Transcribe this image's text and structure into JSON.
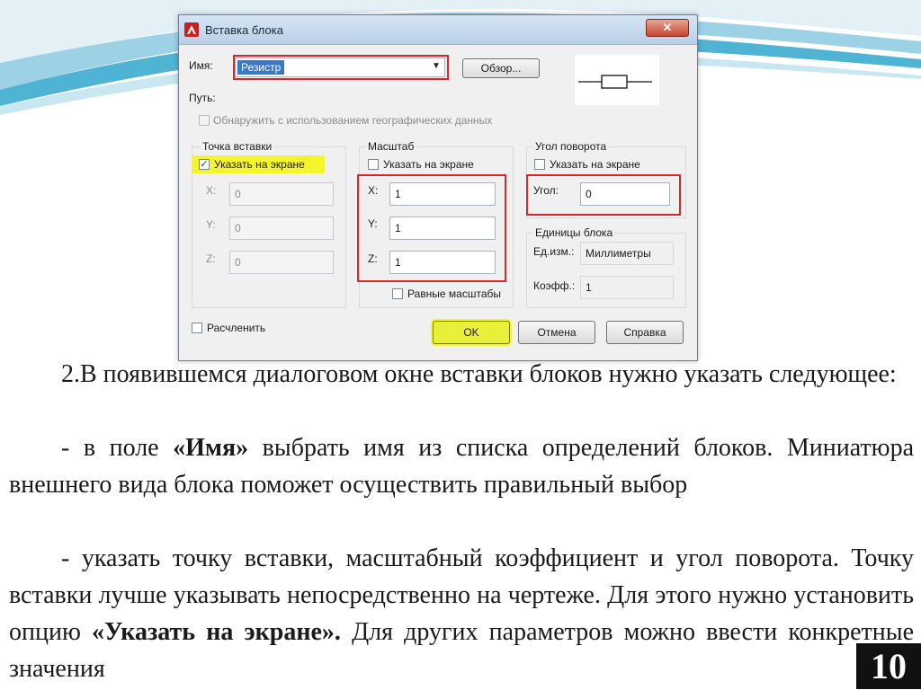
{
  "dialog": {
    "title": "Вставка блока",
    "close_glyph": "✕",
    "name_label": "Имя:",
    "name_value": "Резистр",
    "browse_label": "Обзор...",
    "path_label": "Путь:",
    "geo_checkbox_label": "Обнаружить с использованием географических данных",
    "insertion": {
      "group_label": "Точка вставки",
      "specify_label": "Указать на экране",
      "specify_checked": true,
      "x_label": "X:",
      "x_value": "0",
      "y_label": "Y:",
      "y_value": "0",
      "z_label": "Z:",
      "z_value": "0"
    },
    "scale": {
      "group_label": "Масштаб",
      "specify_label": "Указать на экране",
      "specify_checked": false,
      "x_label": "X:",
      "x_value": "1",
      "y_label": "Y:",
      "y_value": "1",
      "z_label": "Z:",
      "z_value": "1",
      "uniform_label": "Равные масштабы"
    },
    "rotation": {
      "group_label": "Угол поворота",
      "specify_label": "Указать на экране",
      "specify_checked": false,
      "angle_label": "Угол:",
      "angle_value": "0"
    },
    "units": {
      "group_label": "Единицы блока",
      "unit_label": "Ед.изм.:",
      "unit_value": "Миллиметры",
      "factor_label": "Коэфф.:",
      "factor_value": "1"
    },
    "explode_label": "Расчленить",
    "ok_label": "OK",
    "cancel_label": "Отмена",
    "help_label": "Справка"
  },
  "text": {
    "p1": "2.В появившемся диалоговом окне вставки блоков нужно указать следующее:",
    "p2_a": "- в поле ",
    "p2_b": "«Имя»",
    "p2_c": " выбрать имя из списка определений блоков. Миниатюра внешнего вида блока поможет осуществить правильный выбор",
    "p3_a": "- указать точку вставки, масштабный коэффициент и угол поворота. Точку вставки лучше указывать непосредственно на чертеже. Для этого нужно установить опцию ",
    "p3_b": "«Указать на экране».",
    "p3_c": " Для других параметров можно ввести конкретные значения"
  },
  "page_number": "10",
  "colors": {
    "highlight_red": "#d8262b",
    "highlight_yellow": "#f4f52a",
    "ok_button": "#e8f03a",
    "page_number_bg": "#111111"
  }
}
